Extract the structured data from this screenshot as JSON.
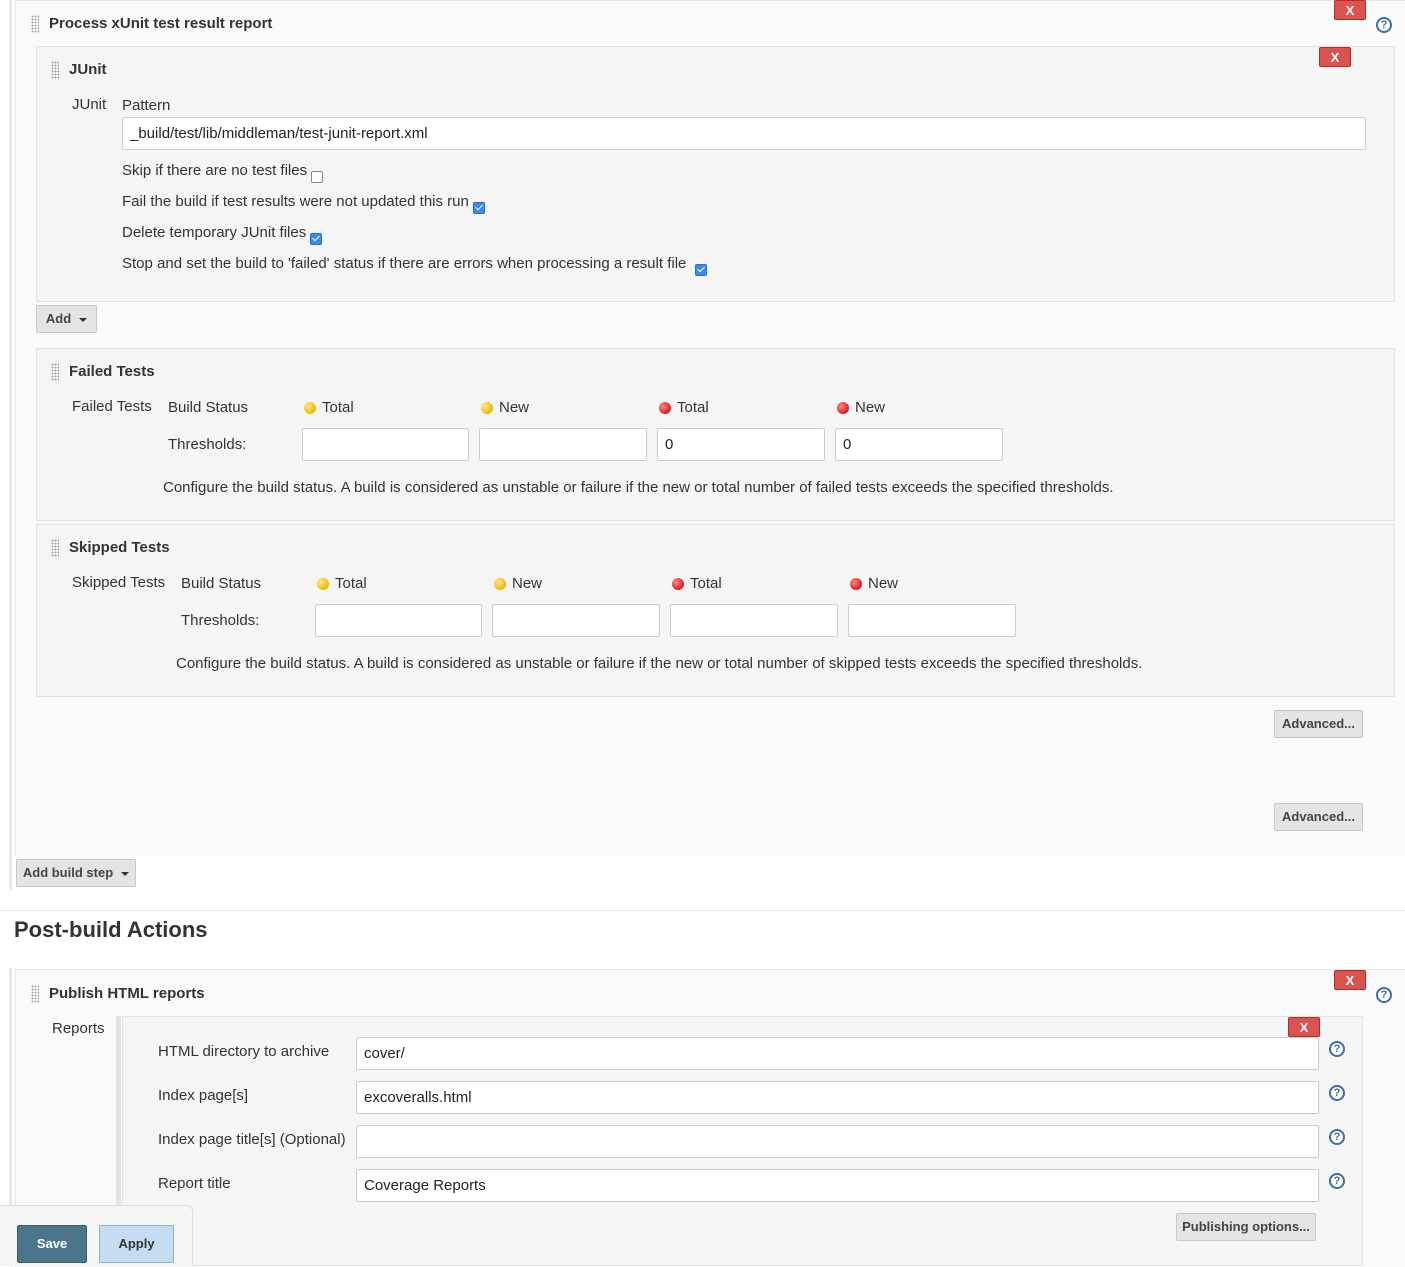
{
  "xunit": {
    "title": "Process xUnit test result report",
    "junit": {
      "title": "JUnit",
      "label": "JUnit",
      "pattern_label": "Pattern",
      "pattern_value": "_build/test/lib/middleman/test-junit-report.xml",
      "options": [
        {
          "label": "Skip if there are no test files",
          "checked": false
        },
        {
          "label": "Fail the build if test results were not updated this run",
          "checked": true
        },
        {
          "label": "Delete temporary JUnit files",
          "checked": true
        },
        {
          "label": "Stop and set the build to 'failed' status if there are errors when processing a result file",
          "checked": true
        }
      ]
    },
    "add_label": "Add",
    "failed": {
      "title": "Failed Tests",
      "label": "Failed Tests",
      "build_status": "Build Status",
      "thresholds": "Thresholds:",
      "cols": [
        "Total",
        "New",
        "Total",
        "New"
      ],
      "values": [
        "",
        "",
        "0",
        "0"
      ],
      "description": "Configure the build status. A build is considered as unstable or failure if the new or total number of failed tests exceeds the specified thresholds."
    },
    "skipped": {
      "title": "Skipped Tests",
      "label": "Skipped Tests",
      "build_status": "Build Status",
      "thresholds": "Thresholds:",
      "cols": [
        "Total",
        "New",
        "Total",
        "New"
      ],
      "values": [
        "",
        "",
        "",
        ""
      ],
      "description": "Configure the build status. A build is considered as unstable or failure if the new or total number of skipped tests exceeds the specified thresholds."
    },
    "advanced_label": "Advanced..."
  },
  "add_build_step_label": "Add build step",
  "post_build": {
    "heading": "Post-build Actions",
    "html_reports": {
      "title": "Publish HTML reports",
      "reports_label": "Reports",
      "fields": [
        {
          "label": "HTML directory to archive",
          "value": "cover/"
        },
        {
          "label": "Index page[s]",
          "value": "excoveralls.html"
        },
        {
          "label": "Index page title[s] (Optional)",
          "value": ""
        },
        {
          "label": "Report title",
          "value": "Coverage Reports"
        }
      ],
      "publishing_options_label": "Publishing options..."
    }
  },
  "footer": {
    "save_label": "Save",
    "apply_label": "Apply"
  },
  "close_label": "X",
  "help_glyph": "?",
  "colors": {
    "danger": "#d9534f",
    "save": "#4b758b",
    "apply": "#c6dcf2",
    "help": "#3a6ea5"
  }
}
